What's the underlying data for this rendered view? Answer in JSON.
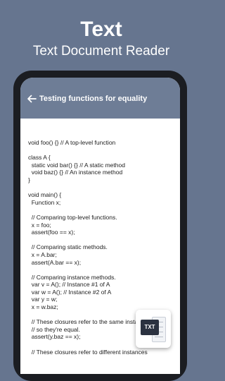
{
  "promo": {
    "title": "Text",
    "subtitle": "Text Document Reader"
  },
  "app_bar": {
    "back_icon": "arrow-left-icon",
    "title": "Testing functions for equality"
  },
  "document": {
    "lines": [
      "void foo() {} // A top-level function",
      "",
      "class A {",
      "  static void bar() {} // A static method",
      "  void baz() {} // An instance method",
      "}",
      "",
      "void main() {",
      "  Function x;",
      "",
      "  // Comparing top-level functions.",
      "  x = foo;",
      "  assert(foo == x);",
      "",
      "  // Comparing static methods.",
      "  x = A.bar;",
      "  assert(A.bar == x);",
      "",
      "  // Comparing instance methods.",
      "  var v = A(); // Instance #1 of A",
      "  var w = A(); // Instance #2 of A",
      "  var y = w;",
      "  x = w.baz;",
      "",
      "  // These closures refer to the same instance,",
      "  // so they're equal.",
      "  assert(y.baz == x);",
      "",
      "  // These closures refer to different instances"
    ]
  },
  "badge": {
    "label": "TXT",
    "icon": "txt-file-icon"
  },
  "colors": {
    "background": "#66758f",
    "app_bar": "#6e7d96",
    "phone_frame": "#1b1d22"
  }
}
